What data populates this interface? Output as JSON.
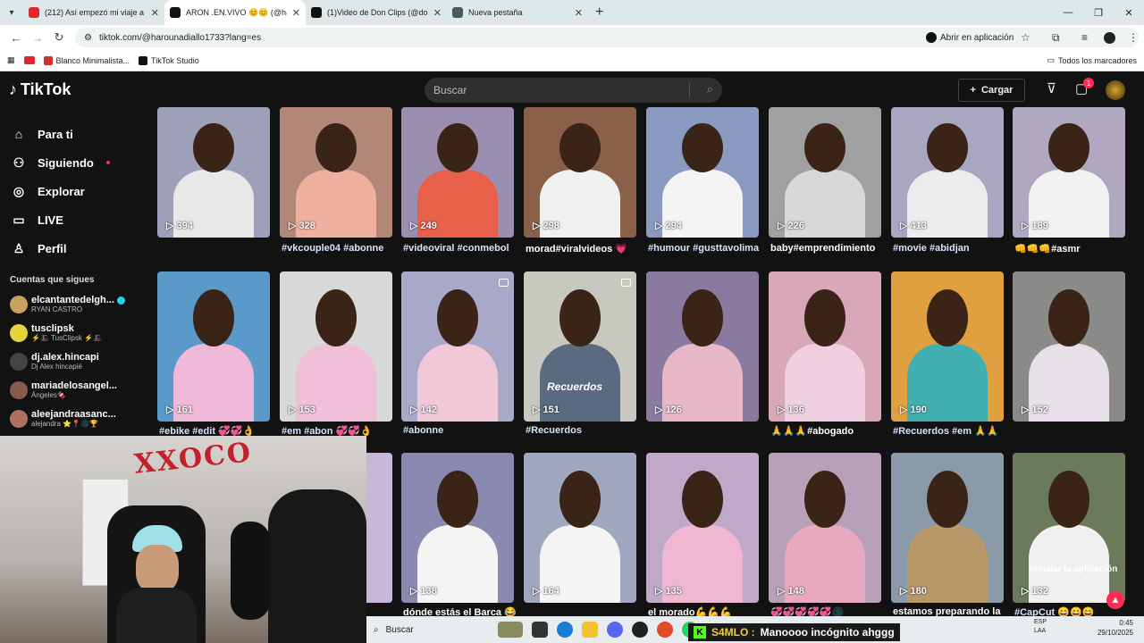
{
  "browser": {
    "tabs": [
      {
        "title": "(212) Así empezó mi viaje a las",
        "color": "#e0262d",
        "active": false
      },
      {
        "title": "ARON .EN.VIVO 😊😊 (@harou",
        "color": "#111111",
        "active": true
      },
      {
        "title": "(1)Video de Don Clips (@donci",
        "color": "#111111",
        "active": false
      },
      {
        "title": "Nueva pestaña",
        "color": "#4a5a5a",
        "active": false
      }
    ],
    "url": "tiktok.com/@harounadiallo1733?lang=es",
    "open_in_app": "Abrir en aplicación",
    "bookmarks": [
      "Blanco Minimalista...",
      "TikTok Studio"
    ],
    "all_bookmarks": "Todos los marcadores"
  },
  "header": {
    "logo_text": "TikTok",
    "search_placeholder": "Buscar",
    "upload_label": "Cargar",
    "notif_count": "1"
  },
  "sidebar": {
    "nav": [
      {
        "label": "Para ti",
        "icon": "home-icon",
        "glyph": "⌂"
      },
      {
        "label": "Siguiendo",
        "icon": "following-icon",
        "glyph": "⚇"
      },
      {
        "label": "Explorar",
        "icon": "compass-icon",
        "glyph": "◎"
      },
      {
        "label": "LIVE",
        "icon": "live-icon",
        "glyph": "▭"
      },
      {
        "label": "Perfil",
        "icon": "profile-icon",
        "glyph": "♙"
      }
    ],
    "following_title": "Cuentas que sigues",
    "accounts": [
      {
        "name": "elcantantedelgh...",
        "sub": "RYAN CASTRO",
        "verified": true,
        "color": "#c9a060"
      },
      {
        "name": "tusclipsk",
        "sub": "⚡🎩 TusClipsk ⚡🎩",
        "verified": false,
        "color": "#e6d23a"
      },
      {
        "name": "dj.alex.hincapi",
        "sub": "Dj Alex hincapié",
        "verified": false,
        "color": "#444444"
      },
      {
        "name": "mariadelosangel...",
        "sub": "Ángeles🍫",
        "verified": false,
        "color": "#8a5a4a"
      },
      {
        "name": "aleejandraasanc...",
        "sub": "alejandra ⭐️📍🌑🏆",
        "verified": false,
        "color": "#b07060"
      }
    ]
  },
  "videos": {
    "row1": [
      {
        "views": "394",
        "caption": "",
        "bg": "#9da0b8",
        "shirt": "#e8e8e8"
      },
      {
        "views": "328",
        "caption": "#vkcouple04 #abonne",
        "bg": "#b48878",
        "shirt": "#f0b0a0"
      },
      {
        "views": "249",
        "caption": "#videoviral #conmebol",
        "bg": "#9a8fb0",
        "shirt": "#e8604a"
      },
      {
        "views": "298",
        "caption": "morad#viralvideos 💗",
        "bg": "#8a6048",
        "shirt": "#f0f0f0"
      },
      {
        "views": "294",
        "caption": "#humour #gusttavolima",
        "bg": "#8a9ac0",
        "shirt": "#f4f4f4"
      },
      {
        "views": "226",
        "caption": "baby#emprendimiento",
        "bg": "#a0a0a0",
        "shirt": "#d8d8d8"
      },
      {
        "views": "413",
        "caption": "#movie #abidjan",
        "bg": "#a8a6c0",
        "shirt": "#ececec"
      },
      {
        "views": "189",
        "caption": "👊👊👊#asmr",
        "bg": "#b0a8c0",
        "shirt": "#f2f2f2"
      }
    ],
    "row2": [
      {
        "views": "161",
        "caption": "#ebike #edit 💞💞👌",
        "bg": "#5a9ac8",
        "shirt": "#f0b8d8"
      },
      {
        "views": "153",
        "caption": "#em #abon 💞💞👌",
        "bg": "#d8d8d8",
        "shirt": "#f0c0d8"
      },
      {
        "views": "142",
        "caption": "#abonne",
        "bg": "#a8a8c8",
        "shirt": "#f0c8d8"
      },
      {
        "views": "151",
        "caption": "#Recuerdos",
        "bg": "#c8c8c0",
        "shirt": "#5a6a80"
      },
      {
        "views": "126",
        "caption": "",
        "bg": "#8a7aa0",
        "shirt": "#e8b8c8"
      },
      {
        "views": "136",
        "caption": "🙏🙏🙏#abogado",
        "bg": "#d8a8b8",
        "shirt": "#f0d0e0"
      },
      {
        "views": "190",
        "caption": "#Recuerdos #em 🙏🙏",
        "bg": "#e0a040",
        "shirt": "#40b0b0"
      },
      {
        "views": "152",
        "caption": "",
        "bg": "#8a8a88",
        "shirt": "#e8e0e8"
      }
    ],
    "row3": [
      {
        "views": "138",
        "caption": "dónde estás el Barca 😂",
        "bg": "#8a8ab0",
        "shirt": "#f4f4f4"
      },
      {
        "views": "164",
        "caption": "",
        "bg": "#a0a8c0",
        "shirt": "#f4f4f4"
      },
      {
        "views": "135",
        "caption": "el morado💪💪💪",
        "bg": "#c0a8c8",
        "shirt": "#f0b8d0"
      },
      {
        "views": "148",
        "caption": "💞💞💞💞💞🌑",
        "bg": "#b8a0b8",
        "shirt": "#e8a8c0"
      },
      {
        "views": "180",
        "caption": "estamos preparando la",
        "bg": "#8a9aa8",
        "shirt": "#b89868"
      },
      {
        "views": "132",
        "caption": "#CapCut 😄😄😄",
        "bg": "#6a7a5a",
        "shirt": "#f0f0f0"
      }
    ],
    "partial_views": "",
    "install_app": "Instalar la aplicación",
    "watermark": "Recuerdos"
  },
  "taskbar": {
    "search": "Buscar",
    "overlay_user": "S4MLO :",
    "overlay_msg": "Manoooo incógnito ahggg",
    "lang": "ESP",
    "lang2": "LAA",
    "time": "0:45",
    "date": "29/10/2025"
  },
  "webcam": {
    "wall_text": "XXOCO"
  }
}
